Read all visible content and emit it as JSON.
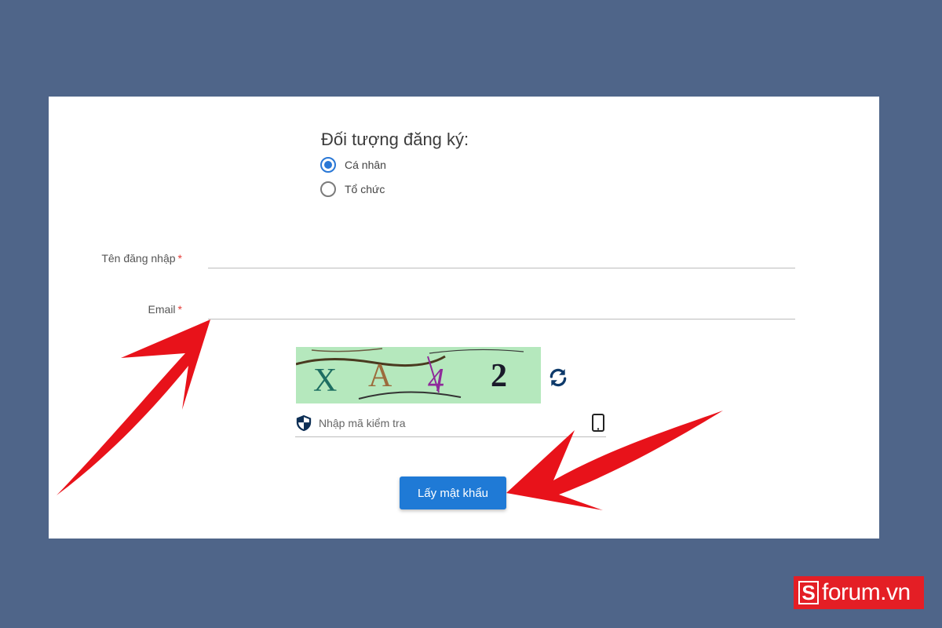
{
  "form": {
    "registrant_title": "Đối tượng đăng ký:",
    "options": [
      {
        "label": "Cá nhân",
        "selected": true
      },
      {
        "label": "Tổ chức",
        "selected": false
      }
    ],
    "username_label": "Tên đăng nhập",
    "email_label": "Email",
    "required_mark": "*",
    "username_value": "",
    "email_value": ""
  },
  "captcha": {
    "chars": [
      "X",
      "A",
      "4",
      "2"
    ],
    "placeholder": "Nhập mã kiểm tra",
    "icons": [
      "shield-icon",
      "refresh-icon",
      "mobile-phone-icon"
    ]
  },
  "submit_label": "Lấy mật khẩu",
  "watermark": {
    "text": "forum.vn",
    "brand_letter": "S"
  },
  "colors": {
    "background": "#4f6589",
    "accent": "#1f7ad6",
    "annotation_arrow": "#e8121a",
    "required": "#e53935"
  }
}
